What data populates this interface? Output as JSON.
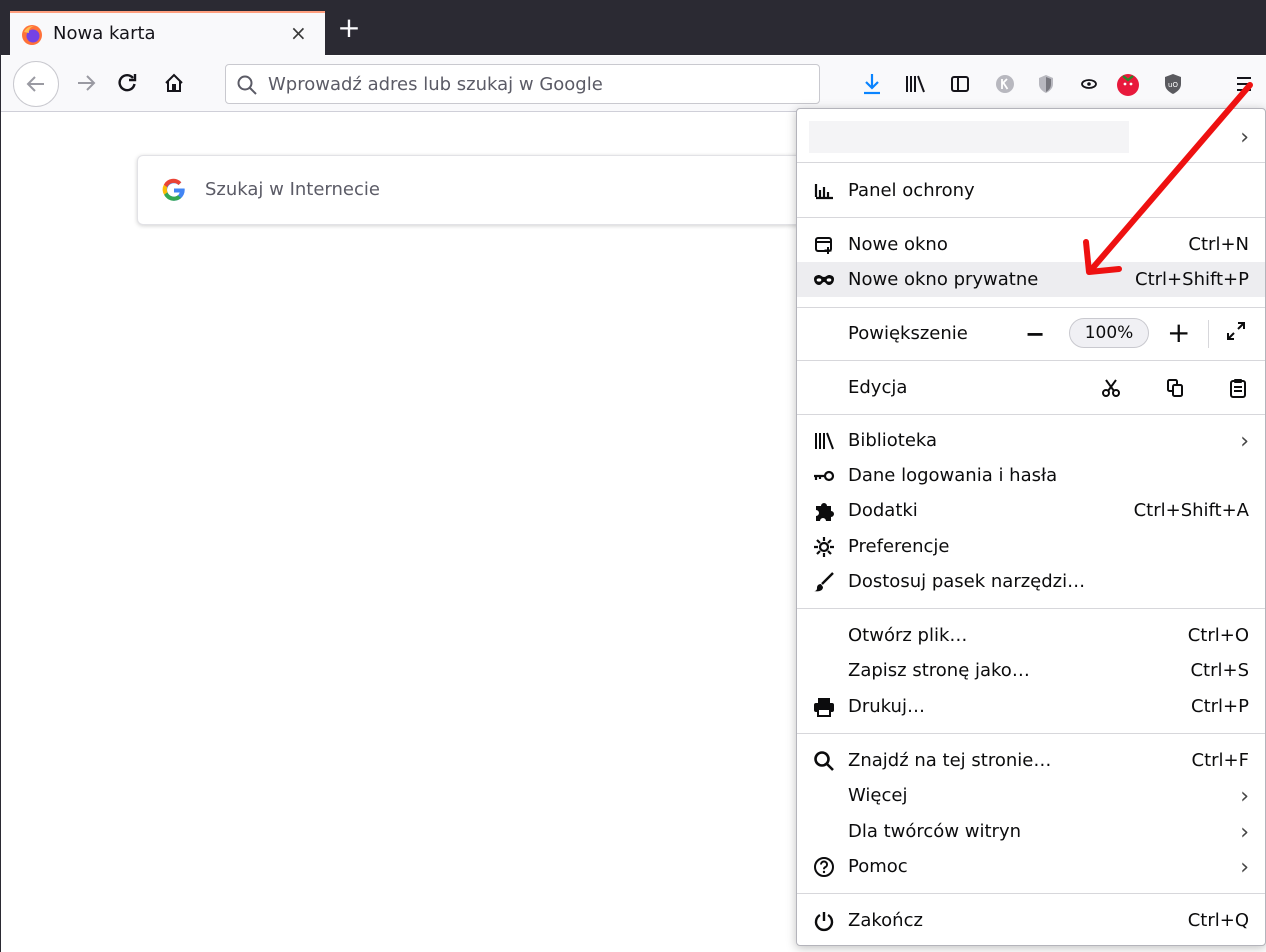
{
  "tab": {
    "title": "Nowa karta",
    "close": "×",
    "new_tab": "+"
  },
  "nav": {
    "url_placeholder": "Wprowadź adres lub szukaj w Google"
  },
  "content": {
    "search_placeholder": "Szukaj w Internecie"
  },
  "menu": {
    "protection_panel": "Panel ochrony",
    "new_window": {
      "label": "Nowe okno",
      "shortcut": "Ctrl+N"
    },
    "new_private_window": {
      "label": "Nowe okno prywatne",
      "shortcut": "Ctrl+Shift+P"
    },
    "zoom": {
      "label": "Powiększenie",
      "minus": "−",
      "value": "100%",
      "plus": "+"
    },
    "edit": {
      "label": "Edycja"
    },
    "library": {
      "label": "Biblioteka"
    },
    "logins": {
      "label": "Dane logowania i hasła"
    },
    "addons": {
      "label": "Dodatki",
      "shortcut": "Ctrl+Shift+A"
    },
    "preferences": {
      "label": "Preferencje"
    },
    "customize": {
      "label": "Dostosuj pasek narzędzi…"
    },
    "open_file": {
      "label": "Otwórz plik…",
      "shortcut": "Ctrl+O"
    },
    "save_page": {
      "label": "Zapisz stronę jako…",
      "shortcut": "Ctrl+S"
    },
    "print": {
      "label": "Drukuj…",
      "shortcut": "Ctrl+P"
    },
    "find": {
      "label": "Znajdź na tej stronie…",
      "shortcut": "Ctrl+F"
    },
    "more": {
      "label": "Więcej"
    },
    "web_developer": {
      "label": "Dla twórców witryn"
    },
    "help": {
      "label": "Pomoc"
    },
    "quit": {
      "label": "Zakończ",
      "shortcut": "Ctrl+Q"
    },
    "chevron": "›"
  },
  "colors": {
    "accent_download": "#0a84ff",
    "annotation_arrow": "#ee1111",
    "highlight": "#ededf0"
  }
}
